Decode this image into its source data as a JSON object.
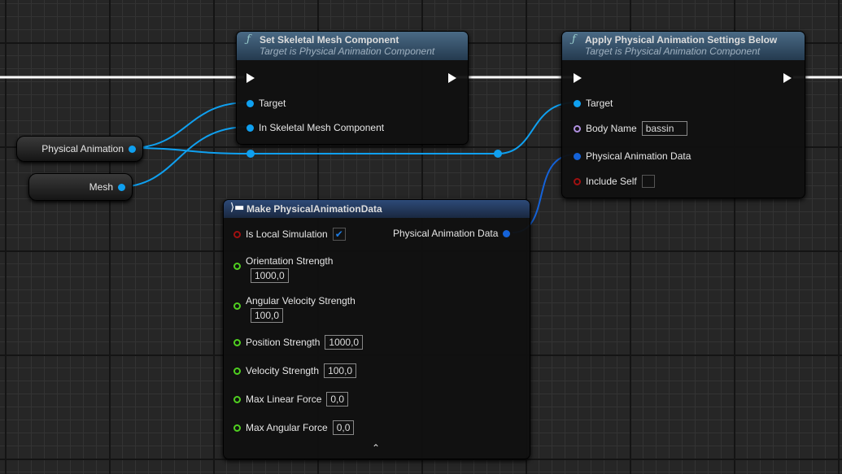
{
  "colors": {
    "object_pin": "#0fa0f0",
    "struct_pin": "#1462d8",
    "bool_pin": "#a01010",
    "float_pin": "#50d020",
    "name_pin": "#b090e0",
    "exec": "#ffffff"
  },
  "variables": [
    {
      "label": "Physical Animation"
    },
    {
      "label": "Mesh"
    }
  ],
  "set_node": {
    "icon": "function-icon",
    "title": "Set Skeletal Mesh Component",
    "subtitle": "Target is Physical Animation Component",
    "pins": [
      "Target",
      "In Skeletal Mesh Component"
    ]
  },
  "apply_node": {
    "icon": "function-icon",
    "title": "Apply Physical Animation Settings Below",
    "subtitle": "Target is Physical Animation Component",
    "target": "Target",
    "body_name_label": "Body Name",
    "body_name_value": "bassin",
    "data_label": "Physical Animation Data",
    "include_self_label": "Include Self",
    "include_self": false
  },
  "make_node": {
    "icon": "make-struct-icon",
    "title": "Make PhysicalAnimationData",
    "output": "Physical Animation Data",
    "is_local_label": "Is Local Simulation",
    "is_local": true,
    "fields": [
      {
        "label": "Orientation Strength",
        "value": "1000,0"
      },
      {
        "label": "Angular Velocity Strength",
        "value": "100,0"
      },
      {
        "label": "Position Strength",
        "value": "1000,0"
      },
      {
        "label": "Velocity Strength",
        "value": "100,0"
      },
      {
        "label": "Max Linear Force",
        "value": "0,0"
      },
      {
        "label": "Max Angular Force",
        "value": "0,0"
      }
    ],
    "collapse_icon": "chevron-up-icon"
  }
}
